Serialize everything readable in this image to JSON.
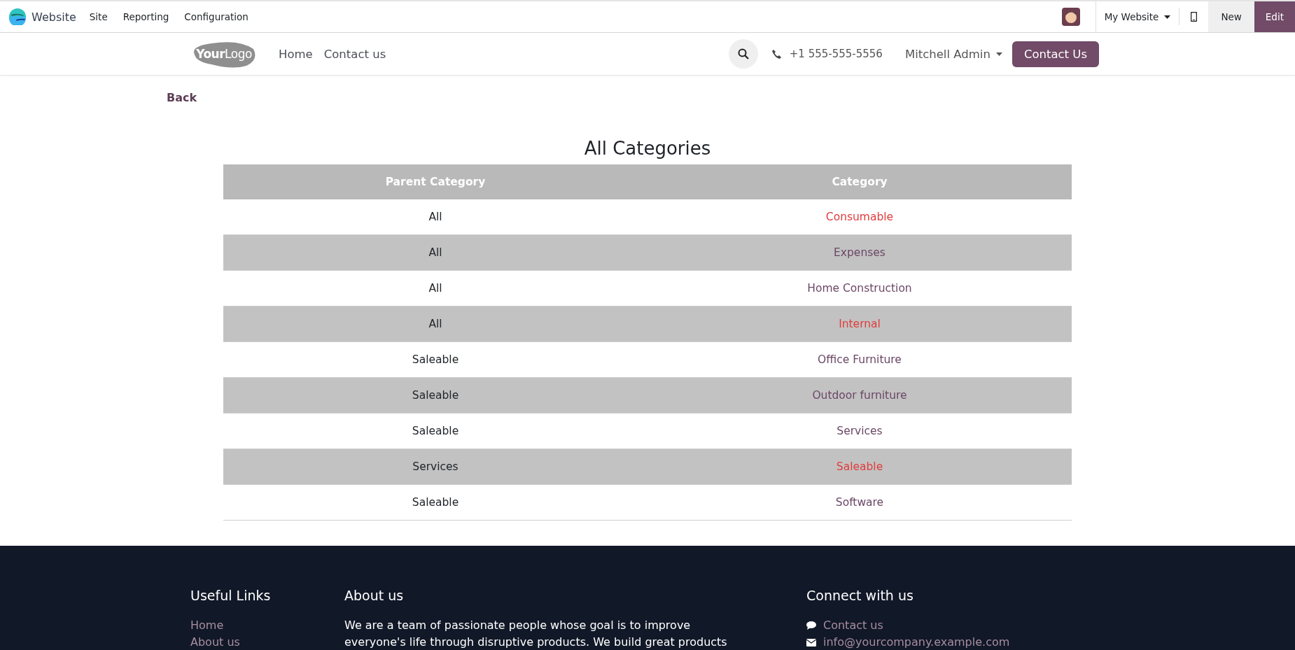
{
  "topbar": {
    "app": "Website",
    "menus": [
      "Site",
      "Reporting",
      "Configuration"
    ],
    "website_switcher": "My Website",
    "new_button": "New",
    "edit_button": "Edit"
  },
  "header": {
    "logo": {
      "bold": "Your",
      "light": "Logo"
    },
    "nav": [
      "Home",
      "Contact us"
    ],
    "phone": "+1 555-555-5556",
    "user": "Mitchell Admin",
    "cta": "Contact Us"
  },
  "back_link": "Back",
  "table": {
    "title": "All Categories",
    "columns": [
      "Parent Category",
      "Category"
    ],
    "rows": [
      {
        "parent": "All",
        "category": "Consumable",
        "color": "#e03c3c"
      },
      {
        "parent": "All",
        "category": "Expenses",
        "color": "#6b4766"
      },
      {
        "parent": "All",
        "category": "Home Construction",
        "color": "#6b4766"
      },
      {
        "parent": "All",
        "category": "Internal",
        "color": "#e03c3c"
      },
      {
        "parent": "Saleable",
        "category": "Office Furniture",
        "color": "#6b4766"
      },
      {
        "parent": "Saleable",
        "category": "Outdoor furniture",
        "color": "#6b4766"
      },
      {
        "parent": "Saleable",
        "category": "Services",
        "color": "#6b4766"
      },
      {
        "parent": "Services",
        "category": "Saleable",
        "color": "#e03c3c"
      },
      {
        "parent": "Saleable",
        "category": "Software",
        "color": "#6b4766"
      }
    ]
  },
  "footer": {
    "useful_links": {
      "title": "Useful Links",
      "links": [
        "Home",
        "About us"
      ]
    },
    "about": {
      "title": "About us",
      "lines": [
        "We are a team of passionate people whose goal is to improve",
        "everyone's life through disruptive products. We build great products"
      ]
    },
    "connect": {
      "title": "Connect with us",
      "items": [
        {
          "kind": "chat",
          "text": "Contact us"
        },
        {
          "kind": "mail",
          "text": "info@yourcompany.example.com"
        }
      ]
    }
  }
}
